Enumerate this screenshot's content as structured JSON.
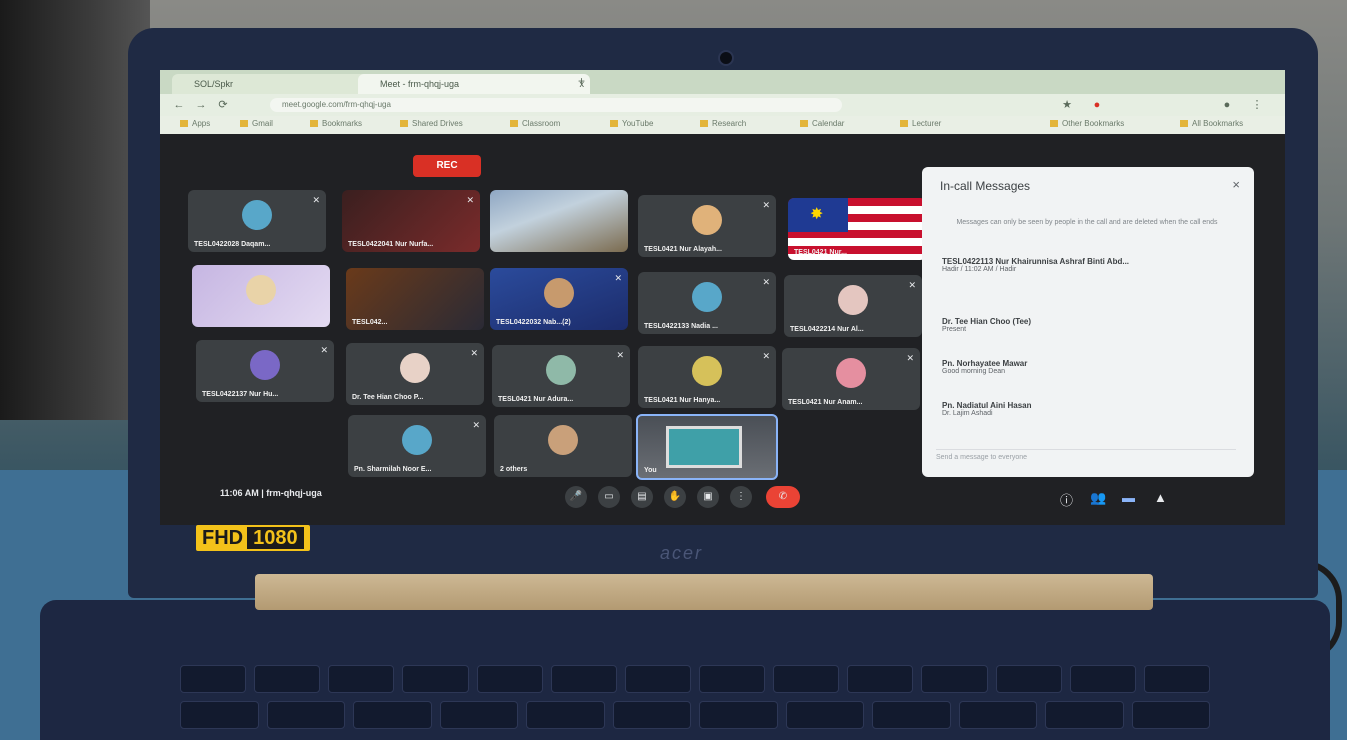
{
  "browser": {
    "tabs": [
      {
        "label": "SOL/Spkr",
        "close": "x"
      },
      {
        "label": "Meet - frm-qhqj-uga",
        "close": "x"
      }
    ],
    "new_tab": "+",
    "url": "meet.google.com/frm-qhqj-uga",
    "bookmarks": [
      "Apps",
      "Gmail",
      "Bookmarks",
      "Shared Drives",
      "Classroom",
      "YouTube",
      "Research",
      "Calendar",
      "Lecturer",
      "Other Bookmarks",
      "All Bookmarks"
    ]
  },
  "meeting": {
    "rec_label": "REC",
    "tiles": [
      {
        "name": "TESL0422028 Daqam..."
      },
      {
        "name": "TESL0422041 Nur Nurfa..."
      },
      {
        "name": ""
      },
      {
        "name": "TESL0421 Nur Alayah..."
      },
      {
        "name": "TESL0421 Nur..."
      },
      {
        "name": ""
      },
      {
        "name": "TESL042..."
      },
      {
        "name": "TESL0422032 Nab...(2)"
      },
      {
        "name": "TESL0422133 Nadia ..."
      },
      {
        "name": "TESL0422214 Nur Al..."
      },
      {
        "name": "TESL0422137 Nur Hu..."
      },
      {
        "name": "Dr. Tee Hian Choo P..."
      },
      {
        "name": "TESL0421 Nur Adura..."
      },
      {
        "name": "TESL0421 Nur Hanya..."
      },
      {
        "name": "TESL0421 Nur Anam..."
      },
      {
        "name": "Pn. Sharmilah Noor E..."
      },
      {
        "name": "2 others"
      },
      {
        "name": "You"
      }
    ],
    "time": "11:06 AM",
    "separator": "|",
    "meeting_code": "frm-qhqj-uga"
  },
  "chat": {
    "title": "In-call Messages",
    "close": "×",
    "note": "Messages can only be seen by people in the call and are deleted when the call ends",
    "messages": [
      {
        "who": "TESL0422113 Nur Khairunnisa Ashraf Binti Abd...",
        "text": "Hadir / 11:02 AM / Hadir"
      },
      {
        "who": "Dr. Tee Hian Choo (Tee)",
        "text": "Present"
      },
      {
        "who": "Pn. Norhayatee Mawar",
        "text": "Good morning Dean"
      },
      {
        "who": "Pn. Nadiatul Aini Hasan",
        "text": "Dr. Lajim Ashadi"
      }
    ],
    "input_placeholder": "Send a message to everyone"
  },
  "laptop": {
    "badge_prefix": "FHD",
    "badge_resolution": "1080",
    "brand": "acer"
  }
}
